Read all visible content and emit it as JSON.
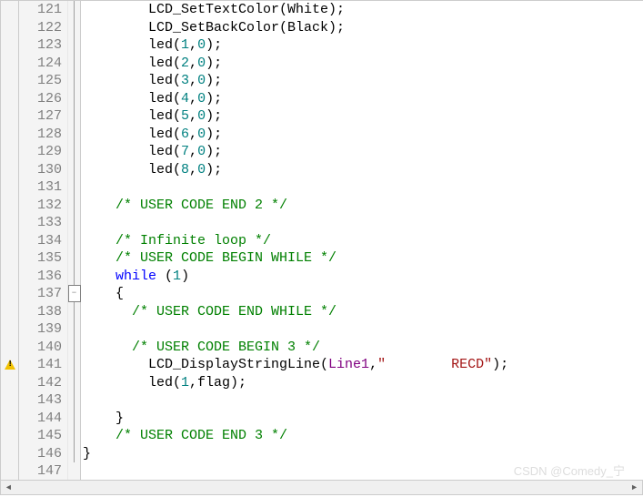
{
  "watermark": "CSDN @Comedy_宁",
  "lines": [
    {
      "num": 121,
      "mark": "",
      "fold": "line",
      "tokens": [
        {
          "t": "        LCD_SetTextColor(White);",
          "c": ""
        }
      ]
    },
    {
      "num": 122,
      "mark": "",
      "fold": "line",
      "tokens": [
        {
          "t": "        LCD_SetBackColor(Black);",
          "c": ""
        }
      ]
    },
    {
      "num": 123,
      "mark": "",
      "fold": "line",
      "tokens": [
        {
          "t": "        led(",
          "c": ""
        },
        {
          "t": "1",
          "c": "c-num"
        },
        {
          "t": ",",
          "c": ""
        },
        {
          "t": "0",
          "c": "c-num"
        },
        {
          "t": ");",
          "c": ""
        }
      ]
    },
    {
      "num": 124,
      "mark": "",
      "fold": "line",
      "tokens": [
        {
          "t": "        led(",
          "c": ""
        },
        {
          "t": "2",
          "c": "c-num"
        },
        {
          "t": ",",
          "c": ""
        },
        {
          "t": "0",
          "c": "c-num"
        },
        {
          "t": ");",
          "c": ""
        }
      ]
    },
    {
      "num": 125,
      "mark": "",
      "fold": "line",
      "tokens": [
        {
          "t": "        led(",
          "c": ""
        },
        {
          "t": "3",
          "c": "c-num"
        },
        {
          "t": ",",
          "c": ""
        },
        {
          "t": "0",
          "c": "c-num"
        },
        {
          "t": ");",
          "c": ""
        }
      ]
    },
    {
      "num": 126,
      "mark": "",
      "fold": "line",
      "tokens": [
        {
          "t": "        led(",
          "c": ""
        },
        {
          "t": "4",
          "c": "c-num"
        },
        {
          "t": ",",
          "c": ""
        },
        {
          "t": "0",
          "c": "c-num"
        },
        {
          "t": ");",
          "c": ""
        }
      ]
    },
    {
      "num": 127,
      "mark": "",
      "fold": "line",
      "tokens": [
        {
          "t": "        led(",
          "c": ""
        },
        {
          "t": "5",
          "c": "c-num"
        },
        {
          "t": ",",
          "c": ""
        },
        {
          "t": "0",
          "c": "c-num"
        },
        {
          "t": ");",
          "c": ""
        }
      ]
    },
    {
      "num": 128,
      "mark": "",
      "fold": "line",
      "tokens": [
        {
          "t": "        led(",
          "c": ""
        },
        {
          "t": "6",
          "c": "c-num"
        },
        {
          "t": ",",
          "c": ""
        },
        {
          "t": "0",
          "c": "c-num"
        },
        {
          "t": ");",
          "c": ""
        }
      ]
    },
    {
      "num": 129,
      "mark": "",
      "fold": "line",
      "tokens": [
        {
          "t": "        led(",
          "c": ""
        },
        {
          "t": "7",
          "c": "c-num"
        },
        {
          "t": ",",
          "c": ""
        },
        {
          "t": "0",
          "c": "c-num"
        },
        {
          "t": ");",
          "c": ""
        }
      ]
    },
    {
      "num": 130,
      "mark": "",
      "fold": "line",
      "tokens": [
        {
          "t": "        led(",
          "c": ""
        },
        {
          "t": "8",
          "c": "c-num"
        },
        {
          "t": ",",
          "c": ""
        },
        {
          "t": "0",
          "c": "c-num"
        },
        {
          "t": ");",
          "c": ""
        }
      ]
    },
    {
      "num": 131,
      "mark": "",
      "fold": "line",
      "tokens": []
    },
    {
      "num": 132,
      "mark": "",
      "fold": "line",
      "tokens": [
        {
          "t": "    ",
          "c": ""
        },
        {
          "t": "/* USER CODE END 2 */",
          "c": "c-cmt"
        }
      ]
    },
    {
      "num": 133,
      "mark": "",
      "fold": "line",
      "tokens": []
    },
    {
      "num": 134,
      "mark": "",
      "fold": "line",
      "tokens": [
        {
          "t": "    ",
          "c": ""
        },
        {
          "t": "/* Infinite loop */",
          "c": "c-cmt"
        }
      ]
    },
    {
      "num": 135,
      "mark": "",
      "fold": "line",
      "tokens": [
        {
          "t": "    ",
          "c": ""
        },
        {
          "t": "/* USER CODE BEGIN WHILE */",
          "c": "c-cmt"
        }
      ]
    },
    {
      "num": 136,
      "mark": "",
      "fold": "line",
      "tokens": [
        {
          "t": "    ",
          "c": ""
        },
        {
          "t": "while",
          "c": "c-kw"
        },
        {
          "t": " (",
          "c": ""
        },
        {
          "t": "1",
          "c": "c-num"
        },
        {
          "t": ")",
          "c": ""
        }
      ]
    },
    {
      "num": 137,
      "mark": "",
      "fold": "box-minus",
      "tokens": [
        {
          "t": "    {",
          "c": ""
        }
      ]
    },
    {
      "num": 138,
      "mark": "",
      "fold": "line",
      "tokens": [
        {
          "t": "      ",
          "c": ""
        },
        {
          "t": "/* USER CODE END WHILE */",
          "c": "c-cmt"
        }
      ]
    },
    {
      "num": 139,
      "mark": "",
      "fold": "line",
      "tokens": []
    },
    {
      "num": 140,
      "mark": "",
      "fold": "line",
      "tokens": [
        {
          "t": "      ",
          "c": ""
        },
        {
          "t": "/* USER CODE BEGIN 3 */",
          "c": "c-cmt"
        }
      ]
    },
    {
      "num": 141,
      "mark": "warn",
      "fold": "line",
      "tokens": [
        {
          "t": "        LCD_DisplayStringLine(",
          "c": ""
        },
        {
          "t": "Line1",
          "c": "c-id2"
        },
        {
          "t": ",",
          "c": ""
        },
        {
          "t": "\"        RECD\"",
          "c": "c-str"
        },
        {
          "t": ");",
          "c": ""
        }
      ]
    },
    {
      "num": 142,
      "mark": "",
      "fold": "line",
      "tokens": [
        {
          "t": "        led(",
          "c": ""
        },
        {
          "t": "1",
          "c": "c-num"
        },
        {
          "t": ",flag);",
          "c": ""
        }
      ]
    },
    {
      "num": 143,
      "mark": "",
      "fold": "line",
      "tokens": []
    },
    {
      "num": 144,
      "mark": "",
      "fold": "line-end",
      "tokens": [
        {
          "t": "    }",
          "c": ""
        }
      ]
    },
    {
      "num": 145,
      "mark": "",
      "fold": "line",
      "tokens": [
        {
          "t": "    ",
          "c": ""
        },
        {
          "t": "/* USER CODE END 3 */",
          "c": "c-cmt"
        }
      ]
    },
    {
      "num": 146,
      "mark": "",
      "fold": "line-end",
      "tokens": [
        {
          "t": "}",
          "c": ""
        }
      ]
    },
    {
      "num": 147,
      "mark": "",
      "fold": "",
      "tokens": []
    }
  ]
}
